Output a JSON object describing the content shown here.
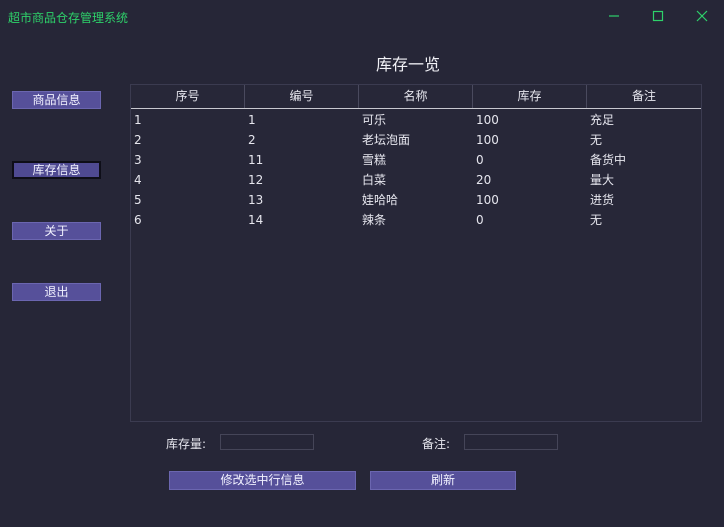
{
  "window": {
    "title": "超市商品仓存管理系统",
    "accent_color": "#2ed16a",
    "controls": [
      "minimize-icon",
      "maximize-icon",
      "close-icon"
    ]
  },
  "page_title": "库存一览",
  "sidebar": {
    "items": [
      {
        "label": "商品信息",
        "active": false
      },
      {
        "label": "库存信息",
        "active": true
      },
      {
        "label": "关于",
        "active": false
      },
      {
        "label": "退出",
        "active": false
      }
    ]
  },
  "table": {
    "headers": [
      "序号",
      "编号",
      "名称",
      "库存",
      "备注"
    ],
    "rows": [
      [
        "1",
        "1",
        "可乐",
        "100",
        "充足"
      ],
      [
        "2",
        "2",
        "老坛泡面",
        "100",
        "无"
      ],
      [
        "3",
        "11",
        "雪糕",
        "0",
        "备货中"
      ],
      [
        "4",
        "12",
        "白菜",
        "20",
        "量大"
      ],
      [
        "5",
        "13",
        "娃哈哈",
        "100",
        "进货"
      ],
      [
        "6",
        "14",
        "辣条",
        "0",
        "无"
      ]
    ]
  },
  "form": {
    "stock_label": "库存量:",
    "stock_value": "",
    "note_label": "备注:",
    "note_value": ""
  },
  "actions": {
    "modify_label": "修改选中行信息",
    "refresh_label": "刷新"
  },
  "colors": {
    "background": "#262637",
    "button": "#56509a"
  }
}
